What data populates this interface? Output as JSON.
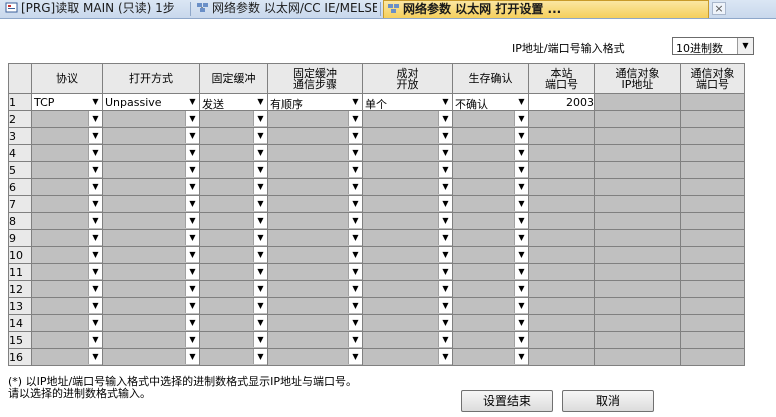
{
  "tabs": [
    {
      "label": "[PRG]读取 MAIN (只读) 1步",
      "icon": "program-icon"
    },
    {
      "label": "网络参数 以太网/CC IE/MELSE...",
      "icon": "network-param-icon"
    },
    {
      "label": "网络参数 以太网 打开设置 ...",
      "icon": "network-param-icon"
    }
  ],
  "close_symbol": "×",
  "ip_format": {
    "label": "IP地址/端口号输入格式",
    "value": "10进制数"
  },
  "dropdown_arrow": "▼",
  "grid": {
    "headers": [
      "协议",
      "打开方式",
      "固定缓冲",
      "固定缓冲\n通信步骤",
      "成对\n开放",
      "生存确认",
      "本站\n端口号",
      "通信对象\nIP地址",
      "通信对象\n端口号"
    ],
    "rows": [
      {
        "no": "1",
        "protocol": "TCP",
        "open_mode": "Unpassive",
        "fixed_buffer": "发送",
        "procedure": "有顺序",
        "pairing": "单个",
        "existence": "不确认",
        "port": "2003"
      },
      {
        "no": "2",
        "protocol": "",
        "open_mode": "",
        "fixed_buffer": "",
        "procedure": "",
        "pairing": "",
        "existence": "",
        "port": ""
      },
      {
        "no": "3",
        "protocol": "",
        "open_mode": "",
        "fixed_buffer": "",
        "procedure": "",
        "pairing": "",
        "existence": "",
        "port": ""
      },
      {
        "no": "4",
        "protocol": "",
        "open_mode": "",
        "fixed_buffer": "",
        "procedure": "",
        "pairing": "",
        "existence": "",
        "port": ""
      },
      {
        "no": "5",
        "protocol": "",
        "open_mode": "",
        "fixed_buffer": "",
        "procedure": "",
        "pairing": "",
        "existence": "",
        "port": ""
      },
      {
        "no": "6",
        "protocol": "",
        "open_mode": "",
        "fixed_buffer": "",
        "procedure": "",
        "pairing": "",
        "existence": "",
        "port": ""
      },
      {
        "no": "7",
        "protocol": "",
        "open_mode": "",
        "fixed_buffer": "",
        "procedure": "",
        "pairing": "",
        "existence": "",
        "port": ""
      },
      {
        "no": "8",
        "protocol": "",
        "open_mode": "",
        "fixed_buffer": "",
        "procedure": "",
        "pairing": "",
        "existence": "",
        "port": ""
      },
      {
        "no": "9",
        "protocol": "",
        "open_mode": "",
        "fixed_buffer": "",
        "procedure": "",
        "pairing": "",
        "existence": "",
        "port": ""
      },
      {
        "no": "10",
        "protocol": "",
        "open_mode": "",
        "fixed_buffer": "",
        "procedure": "",
        "pairing": "",
        "existence": "",
        "port": ""
      },
      {
        "no": "11",
        "protocol": "",
        "open_mode": "",
        "fixed_buffer": "",
        "procedure": "",
        "pairing": "",
        "existence": "",
        "port": ""
      },
      {
        "no": "12",
        "protocol": "",
        "open_mode": "",
        "fixed_buffer": "",
        "procedure": "",
        "pairing": "",
        "existence": "",
        "port": ""
      },
      {
        "no": "13",
        "protocol": "",
        "open_mode": "",
        "fixed_buffer": "",
        "procedure": "",
        "pairing": "",
        "existence": "",
        "port": ""
      },
      {
        "no": "14",
        "protocol": "",
        "open_mode": "",
        "fixed_buffer": "",
        "procedure": "",
        "pairing": "",
        "existence": "",
        "port": ""
      },
      {
        "no": "15",
        "protocol": "",
        "open_mode": "",
        "fixed_buffer": "",
        "procedure": "",
        "pairing": "",
        "existence": "",
        "port": ""
      },
      {
        "no": "16",
        "protocol": "",
        "open_mode": "",
        "fixed_buffer": "",
        "procedure": "",
        "pairing": "",
        "existence": "",
        "port": ""
      }
    ]
  },
  "note": {
    "line1": "(*) 以IP地址/端口号输入格式中选择的进制数格式显示IP地址与端口号。",
    "line2": "请以选择的进制数格式输入。"
  },
  "buttons": {
    "finish": "设置结束",
    "cancel": "取消"
  },
  "colors": {
    "disabled_cell": "#c0c0c0",
    "header_bg": "#e9e9e9",
    "active_tab": "#f5cf5c"
  }
}
